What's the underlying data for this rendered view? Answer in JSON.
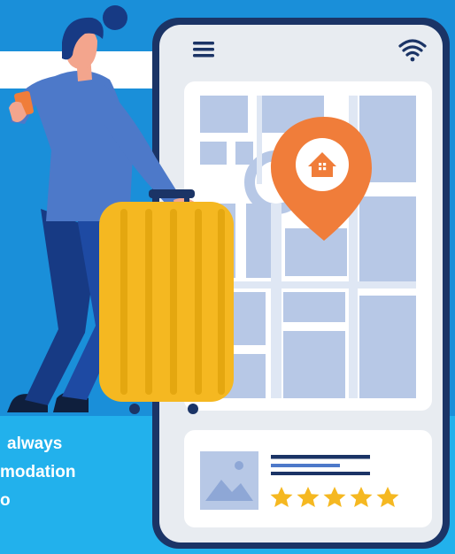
{
  "caption": {
    "line_1": "always",
    "line_2": "modation",
    "line_3": "o"
  },
  "phone": {
    "menu_icon": "hamburger-menu-icon",
    "status_icon": "wifi-icon",
    "rating_stars": 5,
    "rating_max": 5
  },
  "map": {
    "pin_icon": "home-location-pin-icon"
  },
  "colors": {
    "background_dark": "#1a8fd9",
    "background_light": "#22b1ec",
    "phone_frame": "#1b3466",
    "phone_screen": "#e8ecf1",
    "map_blocks": "#b7c8e6",
    "pin": "#f07d3a",
    "suitcase": "#f5b821",
    "star": "#f5b821",
    "shirt": "#4d79c9",
    "pants": "#173a84"
  }
}
